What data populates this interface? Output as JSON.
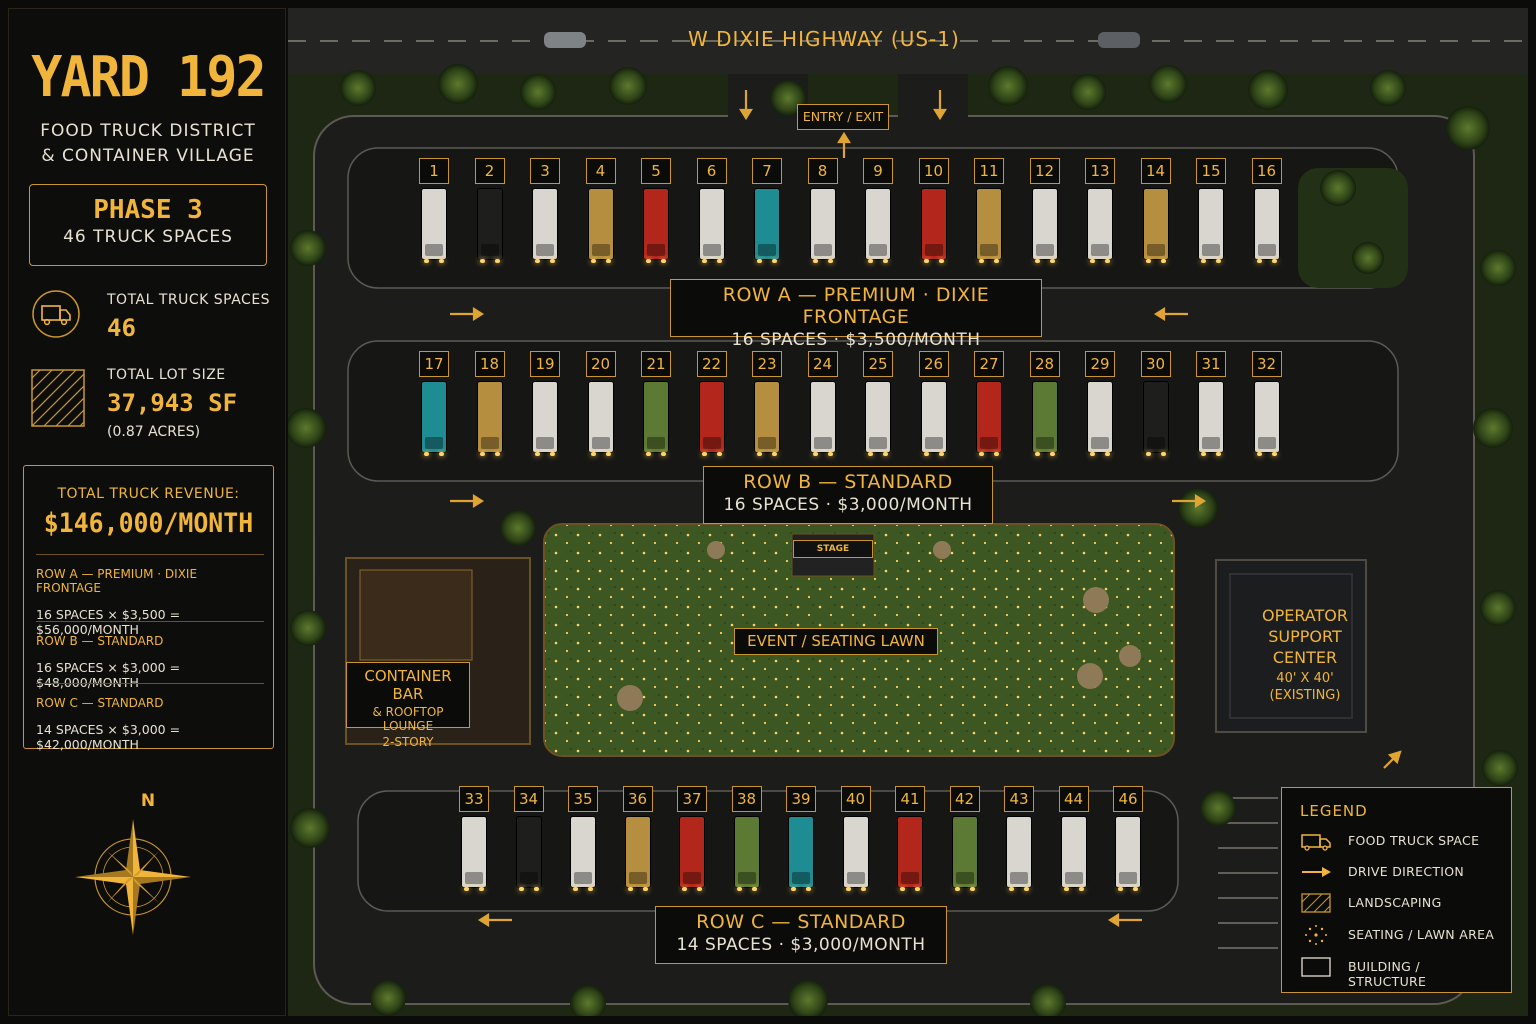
{
  "sidebar": {
    "title": "YARD 192",
    "subtitle_line1": "FOOD TRUCK DISTRICT",
    "subtitle_line2": "& CONTAINER VILLAGE",
    "phase_title": "PHASE 3",
    "phase_sub": "46 TRUCK SPACES",
    "stats": [
      {
        "icon": "food-truck-icon",
        "label": "TOTAL TRUCK SPACES",
        "value": "46",
        "note": ""
      },
      {
        "icon": "landscaping-hatch-icon",
        "label": "TOTAL LOT SIZE",
        "value": "37,943 SF",
        "note": "(0.87 ACRES)"
      }
    ],
    "revenue": {
      "label": "TOTAL TRUCK REVENUE:",
      "total": "$146,000/MONTH",
      "rows": [
        {
          "name": "ROW A — PREMIUM · DIXIE FRONTAGE",
          "calc": "16 SPACES × $3,500 = $56,000/MONTH"
        },
        {
          "name": "ROW B — STANDARD",
          "calc": "16 SPACES × $3,000 = $48,000/MONTH"
        },
        {
          "name": "ROW C — STANDARD",
          "calc": "14 SPACES × $3,000 = $42,000/MONTH"
        }
      ]
    },
    "compass_label": "N"
  },
  "map": {
    "highway": "W DIXIE HIGHWAY (US-1)",
    "entry": "ENTRY / EXIT",
    "rows": [
      {
        "title": "ROW A — PREMIUM · DIXIE FRONTAGE",
        "sub": "16 SPACES  ·  $3,500/MONTH"
      },
      {
        "title": "ROW B — STANDARD",
        "sub": "16 SPACES  ·  $3,000/MONTH"
      },
      {
        "title": "ROW C — STANDARD",
        "sub": "14 SPACES  ·  $3,000/MONTH"
      }
    ],
    "container_bar": {
      "line1": "CONTAINER BAR",
      "line2": "& ROOFTOP LOUNGE",
      "line3": "2-STORY"
    },
    "operator": {
      "line1": "OPERATOR",
      "line2": "SUPPORT",
      "line3": "CENTER",
      "line4": "40' X 40'",
      "line5": "(EXISTING)"
    },
    "lawn": "EVENT / SEATING LAWN",
    "stage": "STAGE",
    "truck_colors": {
      "white": "#d9d6cf",
      "black": "#1e1e1d",
      "gold": "#b58f3f",
      "red": "#b3261c",
      "teal": "#1e8c93",
      "green": "#5d7a34"
    },
    "slots": {
      "row_a": [
        {
          "num": "1",
          "color": "white"
        },
        {
          "num": "2",
          "color": "black"
        },
        {
          "num": "3",
          "color": "white"
        },
        {
          "num": "4",
          "color": "gold"
        },
        {
          "num": "5",
          "color": "red"
        },
        {
          "num": "6",
          "color": "white"
        },
        {
          "num": "7",
          "color": "teal"
        },
        {
          "num": "8",
          "color": "white"
        },
        {
          "num": "9",
          "color": "white"
        },
        {
          "num": "10",
          "color": "red"
        },
        {
          "num": "11",
          "color": "gold"
        },
        {
          "num": "12",
          "color": "white"
        },
        {
          "num": "13",
          "color": "white"
        },
        {
          "num": "14",
          "color": "gold"
        },
        {
          "num": "15",
          "color": "white"
        },
        {
          "num": "16",
          "color": "white"
        }
      ],
      "row_b": [
        {
          "num": "17",
          "color": "teal"
        },
        {
          "num": "18",
          "color": "gold"
        },
        {
          "num": "19",
          "color": "white"
        },
        {
          "num": "20",
          "color": "white"
        },
        {
          "num": "21",
          "color": "green"
        },
        {
          "num": "22",
          "color": "red"
        },
        {
          "num": "23",
          "color": "gold"
        },
        {
          "num": "24",
          "color": "white"
        },
        {
          "num": "25",
          "color": "white"
        },
        {
          "num": "26",
          "color": "white"
        },
        {
          "num": "27",
          "color": "red"
        },
        {
          "num": "28",
          "color": "green"
        },
        {
          "num": "29",
          "color": "white"
        },
        {
          "num": "30",
          "color": "black"
        },
        {
          "num": "31",
          "color": "white"
        },
        {
          "num": "32",
          "color": "white"
        }
      ],
      "row_c": [
        {
          "num": "33",
          "color": "white"
        },
        {
          "num": "34",
          "color": "black"
        },
        {
          "num": "35",
          "color": "white"
        },
        {
          "num": "36",
          "color": "gold"
        },
        {
          "num": "37",
          "color": "red"
        },
        {
          "num": "38",
          "color": "green"
        },
        {
          "num": "39",
          "color": "teal"
        },
        {
          "num": "40",
          "color": "white"
        },
        {
          "num": "41",
          "color": "red"
        },
        {
          "num": "42",
          "color": "green"
        },
        {
          "num": "43",
          "color": "white"
        },
        {
          "num": "44",
          "color": "white"
        },
        {
          "num": "46",
          "color": "white"
        }
      ]
    }
  },
  "legend": {
    "title": "LEGEND",
    "items": [
      {
        "icon": "food-truck-icon",
        "label": "FOOD TRUCK SPACE"
      },
      {
        "icon": "arrow-right-icon",
        "label": "DRIVE DIRECTION"
      },
      {
        "icon": "landscaping-hatch-icon",
        "label": "LANDSCAPING"
      },
      {
        "icon": "string-lights-icon",
        "label": "SEATING / LAWN AREA"
      },
      {
        "icon": "building-outline-icon",
        "label": "BUILDING / STRUCTURE"
      }
    ]
  },
  "colors": {
    "accent": "#f0b53a",
    "text_light": "#e8e2d2",
    "background": "#0b0b0a",
    "lawn": "#3f5a22",
    "road": "#1c1c1b"
  }
}
